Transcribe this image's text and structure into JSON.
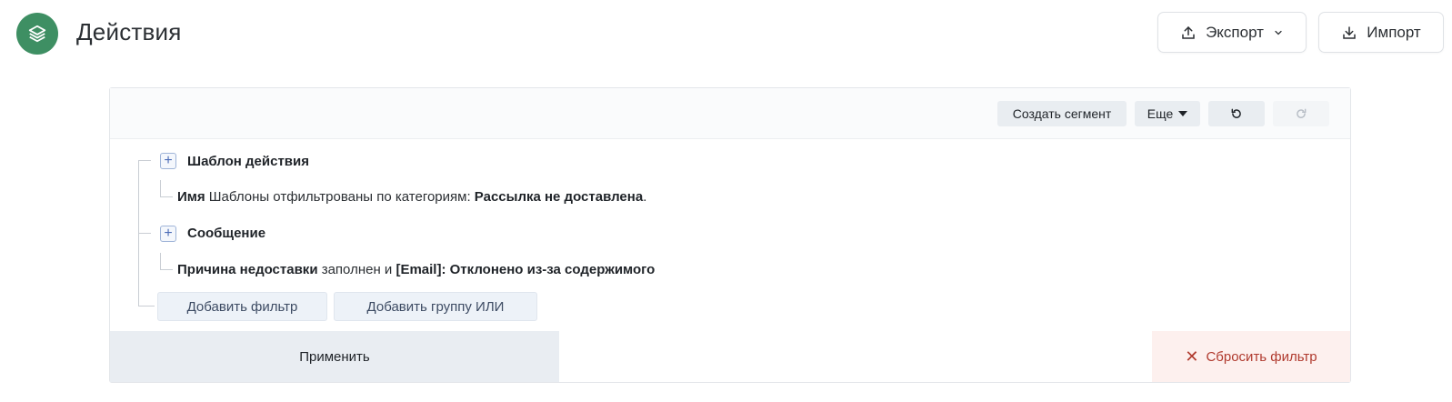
{
  "header": {
    "title": "Действия",
    "logo_icon": "layers-icon",
    "logo_color": "#3e8f63",
    "export_label": "Экспорт",
    "import_label": "Импорт"
  },
  "toolbar": {
    "create_segment": "Создать сегмент",
    "more": "Еще",
    "undo_icon": "undo-icon",
    "redo_icon": "redo-icon"
  },
  "filters": {
    "groups": [
      {
        "label": "Шаблон действия",
        "condition": {
          "field": "Имя",
          "text": " Шаблоны отфильтрованы по категориям: ",
          "value": "Рассылка не доставлена",
          "suffix": "."
        }
      },
      {
        "label": "Сообщение",
        "condition": {
          "field": "Причина недоставки",
          "text": " заполнен и ",
          "value": "[Email]: Отклонено из-за содержимого"
        }
      }
    ],
    "add_filter": "Добавить фильтр",
    "add_or_group": "Добавить группу ИЛИ"
  },
  "footer": {
    "apply": "Применить",
    "reset": "Сбросить фильтр"
  },
  "colors": {
    "accent": "#3e8f63",
    "reset_text": "#b03a2e",
    "reset_bg": "#fdf0ee"
  }
}
